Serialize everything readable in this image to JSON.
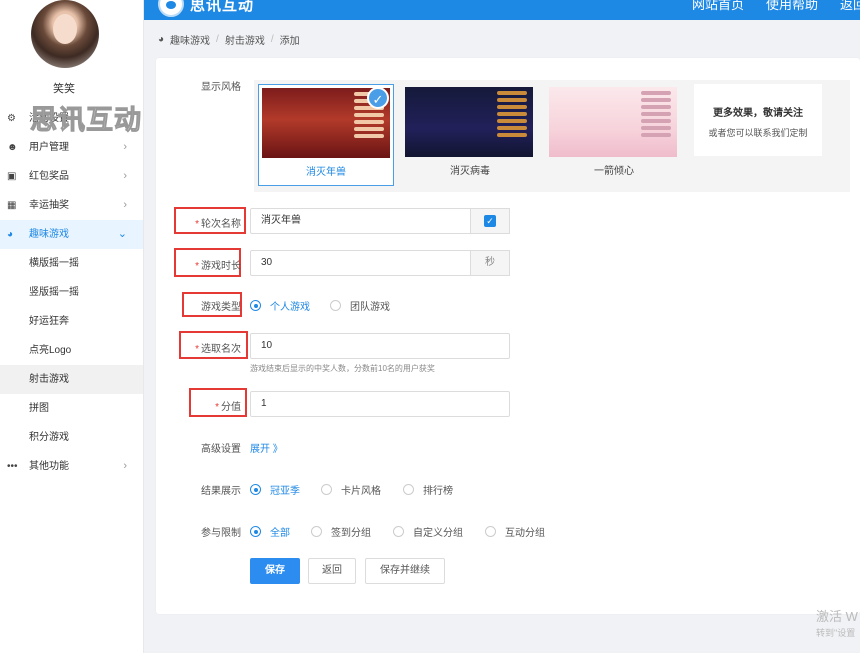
{
  "header": {
    "brand": "思讯互动",
    "links": [
      "网站首页",
      "使用帮助",
      "返回"
    ]
  },
  "sidebar": {
    "username": "笑笑",
    "watermark": "思讯互动",
    "items": [
      {
        "label": "活动设置",
        "icon": "gear-icon"
      },
      {
        "label": "用户管理",
        "icon": "user-icon"
      },
      {
        "label": "红包奖品",
        "icon": "gift-icon"
      },
      {
        "label": "幸运抽奖",
        "icon": "lottery-icon"
      },
      {
        "label": "趣味游戏",
        "icon": "game-icon"
      },
      {
        "label": "横版摇一摇"
      },
      {
        "label": "竖版摇一摇"
      },
      {
        "label": "好运狂奔"
      },
      {
        "label": "点亮Logo"
      },
      {
        "label": "射击游戏"
      },
      {
        "label": "拼图"
      },
      {
        "label": "积分游戏"
      },
      {
        "label": "其他功能",
        "icon": "more-icon"
      }
    ]
  },
  "breadcrumb": [
    "趣味游戏",
    "射击游戏",
    "添加"
  ],
  "form": {
    "style_label": "显示风格",
    "styles": [
      {
        "caption": "消灭年兽",
        "selected": true
      },
      {
        "caption": "消灭病毒",
        "selected": false
      },
      {
        "caption": "一箭倾心",
        "selected": false
      }
    ],
    "more_title": "更多效果，敬请关注",
    "more_sub": "或者您可以联系我们定制",
    "round_name_label": "轮次名称",
    "round_name_value": "消灭年兽",
    "duration_label": "游戏时长",
    "duration_value": "30",
    "duration_unit": "秒",
    "type_label": "游戏类型",
    "type_options": [
      "个人游戏",
      "团队游戏"
    ],
    "rank_label": "选取名次",
    "rank_value": "10",
    "rank_hint": "游戏结束后显示的中奖人数，分数前10名的用户获奖",
    "score_label": "分值",
    "score_value": "1",
    "advanced_label": "高级设置",
    "advanced_link": "展开 》",
    "result_label": "结果展示",
    "result_options": [
      "冠亚季",
      "卡片风格",
      "排行榜"
    ],
    "limit_label": "参与限制",
    "limit_options": [
      "全部",
      "签到分组",
      "自定义分组",
      "互动分组"
    ],
    "required_mark": "*"
  },
  "buttons": {
    "save": "保存",
    "back": "返回",
    "save_continue": "保存并继续"
  },
  "system": {
    "activate_line1": "激活 W",
    "activate_line2": "转到\"设置"
  },
  "colors": {
    "primary": "#1e88e5",
    "required": "#e53935",
    "highlight_box": "#e53935"
  }
}
